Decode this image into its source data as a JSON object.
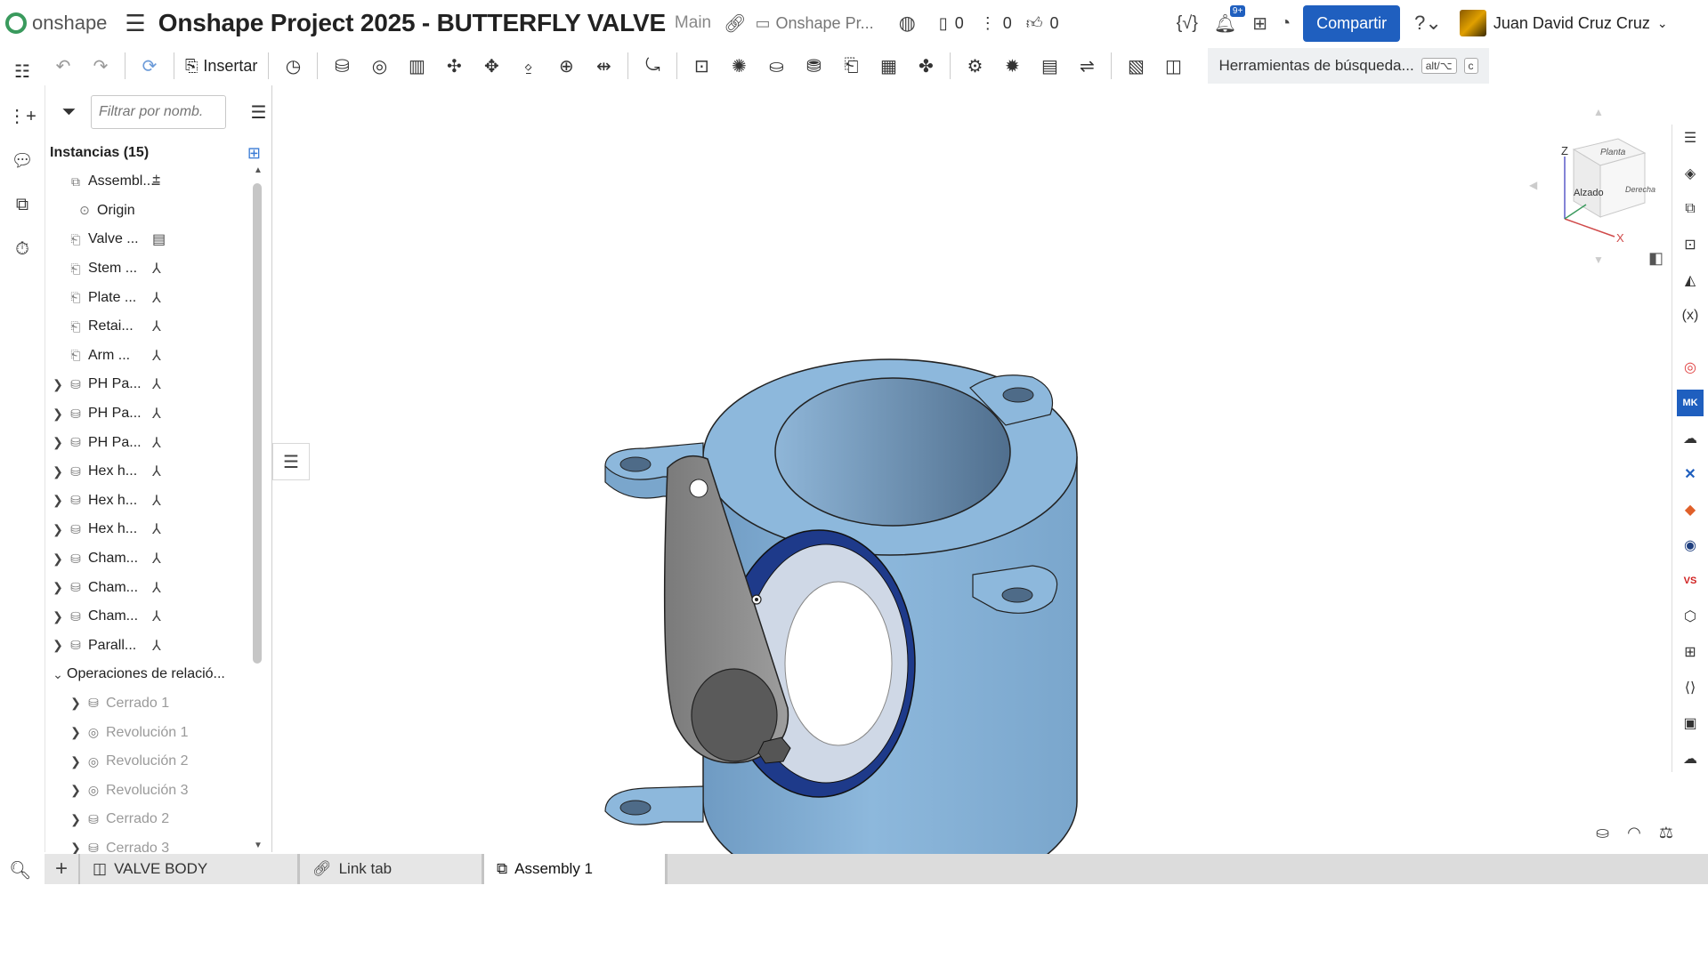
{
  "app": {
    "logo_text": "onshape",
    "document_title": "Onshape Project 2025 - BUTTERFLY VALVE",
    "branch": "Main",
    "folder": "Onshape Pr...",
    "versions_count": "0",
    "branches_count": "0",
    "likes_count": "0",
    "notifications_badge": "9+",
    "share_label": "Compartir",
    "user_name": "Juan David Cruz Cruz"
  },
  "toolbar": {
    "insert_label": "Insertar",
    "search_tools_label": "Herramientas de búsqueda...",
    "search_shortcut_1": "alt/⌥",
    "search_shortcut_2": "c"
  },
  "panel": {
    "filter_placeholder": "Filtrar por nomb.",
    "instances_label": "Instancias (15)",
    "items": [
      {
        "label": "Assembl...",
        "icon": "assembly-icon",
        "caret": "",
        "suffix": "⩲",
        "dim": false
      },
      {
        "label": "Origin",
        "icon": "origin-icon",
        "caret": "",
        "suffix": "",
        "dim": false,
        "indent": true
      },
      {
        "label": "Valve ...",
        "icon": "part-icon",
        "caret": "",
        "suffix": "▤",
        "dim": false
      },
      {
        "label": "Stem ...",
        "icon": "part-icon",
        "caret": "",
        "suffix": "⅄",
        "dim": false
      },
      {
        "label": "Plate ...",
        "icon": "part-icon",
        "caret": "",
        "suffix": "⅄",
        "dim": false
      },
      {
        "label": "Retai...",
        "icon": "part-icon",
        "caret": "",
        "suffix": "⅄",
        "dim": false
      },
      {
        "label": "Arm ...",
        "icon": "part-icon",
        "caret": "",
        "suffix": "⅄",
        "dim": false
      },
      {
        "label": "PH Pa...",
        "icon": "fastener-icon",
        "caret": "›",
        "suffix": "⅄",
        "dim": false
      },
      {
        "label": "PH Pa...",
        "icon": "fastener-icon",
        "caret": "›",
        "suffix": "⅄",
        "dim": false
      },
      {
        "label": "PH Pa...",
        "icon": "fastener-icon",
        "caret": "›",
        "suffix": "⅄",
        "dim": false
      },
      {
        "label": "Hex h...",
        "icon": "fastener-icon",
        "caret": "›",
        "suffix": "⅄",
        "dim": false
      },
      {
        "label": "Hex h...",
        "icon": "fastener-icon",
        "caret": "›",
        "suffix": "⅄",
        "dim": false
      },
      {
        "label": "Hex h...",
        "icon": "fastener-icon",
        "caret": "›",
        "suffix": "⅄",
        "dim": false
      },
      {
        "label": "Cham...",
        "icon": "fastener-icon",
        "caret": "›",
        "suffix": "⅄",
        "dim": false
      },
      {
        "label": "Cham...",
        "icon": "fastener-icon",
        "caret": "›",
        "suffix": "⅄",
        "dim": false
      },
      {
        "label": "Cham...",
        "icon": "fastener-icon",
        "caret": "›",
        "suffix": "⅄",
        "dim": false
      },
      {
        "label": "Parall...",
        "icon": "fastener-icon",
        "caret": "›",
        "suffix": "⅄",
        "dim": false
      }
    ],
    "mates_group_label": "Operaciones de relació...",
    "mates": [
      {
        "label": "Cerrado 1",
        "icon": "fastened-mate-icon"
      },
      {
        "label": "Revolución 1",
        "icon": "revolute-mate-icon"
      },
      {
        "label": "Revolución 2",
        "icon": "revolute-mate-icon"
      },
      {
        "label": "Revolución 3",
        "icon": "revolute-mate-icon"
      },
      {
        "label": "Cerrado 2",
        "icon": "fastened-mate-icon"
      },
      {
        "label": "Cerrado 3",
        "icon": "fastened-mate-icon"
      }
    ]
  },
  "tabs": [
    {
      "label": "VALVE BODY",
      "icon": "part-studio-icon",
      "active": false
    },
    {
      "label": "Link tab",
      "icon": "link-icon",
      "active": false
    },
    {
      "label": "Assembly 1",
      "icon": "assembly-icon",
      "active": true
    }
  ],
  "viewcube": {
    "top_face": "Planta",
    "front_face": "Alzado",
    "right_face": "Derecha",
    "axis_z": "Z",
    "axis_x": "X"
  },
  "colors": {
    "share_button": "#1f5fbf",
    "onshape_green": "#3a9a5d",
    "model_body": "#89b3d6",
    "model_arm": "#8c8c8c",
    "model_plate": "#1e3a8a"
  }
}
